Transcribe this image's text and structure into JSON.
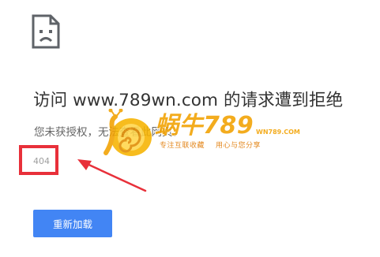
{
  "error": {
    "icon": "sad-page-icon",
    "title": "访问 www.789wn.com 的请求遭到拒绝",
    "description": "您未获授权，无法查看此网页。",
    "code": "404"
  },
  "actions": {
    "reload_label": "重新加载",
    "button_color": "#4285f4"
  },
  "annotation": {
    "box_color": "#e8303a",
    "arrow_color": "#e8303a"
  },
  "watermark": {
    "brand": "蜗牛789",
    "domain": "WN789.COM",
    "slogan_left": "专注互联收藏",
    "slogan_right": "用心与您分享",
    "color": "#f2a100"
  }
}
